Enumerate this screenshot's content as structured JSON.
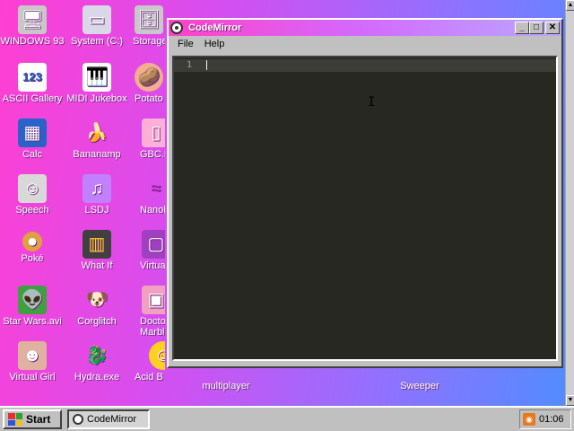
{
  "desktop": {
    "icons": [
      {
        "label": "WINDOWS 93",
        "glyph": "🖥",
        "bg": "#c8c8c8"
      },
      {
        "label": "System (C:)",
        "glyph": "▭",
        "bg": "#d8d8e8"
      },
      {
        "label": "Storage",
        "glyph": "🗄",
        "bg": "#c8c8c8"
      },
      {
        "label": "ASCII Gallery",
        "glyph": "123",
        "bg": "#ffffff"
      },
      {
        "label": "MIDI Jukebox",
        "glyph": "🎹",
        "bg": "#ffffff"
      },
      {
        "label": "Potato",
        "glyph": "🥔",
        "bg": "#f0b090"
      },
      {
        "label": "Calc",
        "glyph": "▦",
        "bg": "#2a62c8"
      },
      {
        "label": "Bananamp",
        "glyph": "🍌",
        "bg": "#ffd020"
      },
      {
        "label": "GBC.N",
        "glyph": "▯",
        "bg": "#ffb0d8"
      },
      {
        "label": "Speech",
        "glyph": "☺",
        "bg": "#d8d8d8"
      },
      {
        "label": "LSDJ",
        "glyph": "♫",
        "bg": "#c080ff"
      },
      {
        "label": "Nanol",
        "glyph": "≈",
        "bg": "#b020b0"
      },
      {
        "label": "Poké",
        "glyph": "●",
        "bg": "#e0a040"
      },
      {
        "label": "What If",
        "glyph": "▥",
        "bg": "#404040"
      },
      {
        "label": "Virtual",
        "glyph": "▢",
        "bg": "#a040c0"
      },
      {
        "label": "Star Wars.avi",
        "glyph": "👽",
        "bg": "#40a040"
      },
      {
        "label": "Corglitch",
        "glyph": "🐶",
        "bg": "#f0b060"
      },
      {
        "label": "Doctor Marble",
        "glyph": "▣",
        "bg": "#f0a0c0"
      },
      {
        "label": "Virtual Girl",
        "glyph": "☻",
        "bg": "#e0b0a0"
      },
      {
        "label": "Hydra.exe",
        "glyph": "🐉",
        "bg": "#208040"
      },
      {
        "label": "Acid B",
        "glyph": "☺",
        "bg": "#ffd020"
      },
      {
        "label": "multiplayer",
        "glyph": "",
        "bg": "transparent"
      },
      {
        "label": "Sweeper",
        "glyph": "",
        "bg": "transparent"
      }
    ]
  },
  "window": {
    "title": "CodeMirror",
    "controls": {
      "minimize": "_",
      "maximize": "□",
      "close": "✕"
    },
    "menu": [
      "File",
      "Help"
    ],
    "editor": {
      "line_number": "1",
      "content": "",
      "theme_bg": "#272822"
    }
  },
  "taskbar": {
    "start_label": "Start",
    "task_label": "CodeMirror",
    "clock": "01:06"
  },
  "colors": {
    "title_start": "#ff40c8",
    "title_end": "#b9a8ff",
    "editor_bg": "#272822"
  }
}
